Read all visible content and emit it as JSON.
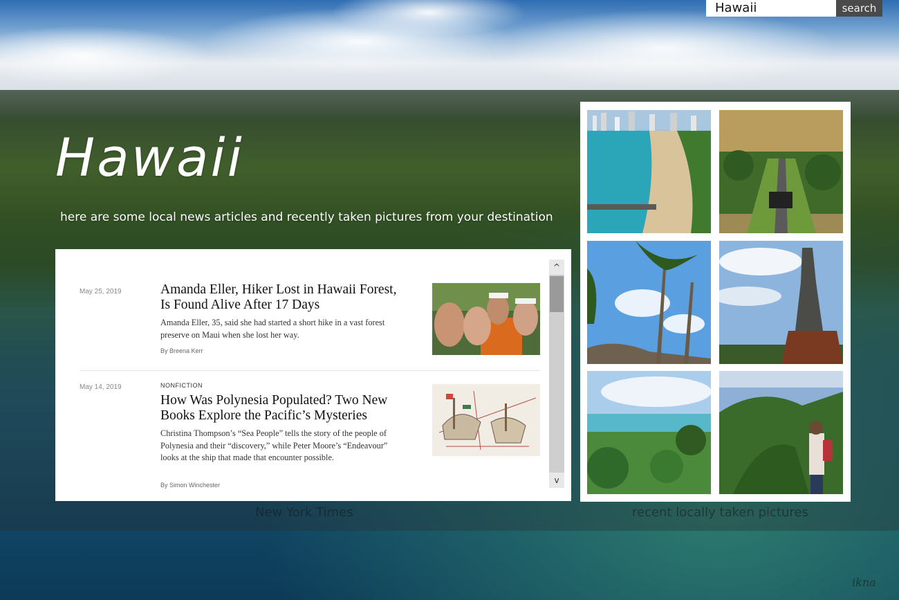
{
  "search": {
    "value": "Hawaii",
    "button_label": "search"
  },
  "hero": {
    "title": "Hawaii",
    "subtitle": "here are some local news articles and recently taken pictures from your destination"
  },
  "news": {
    "articles": [
      {
        "date": "May 25, 2019",
        "kicker": "",
        "title": "Amanda Eller, Hiker Lost in Hawaii Forest, Is Found Alive After 17 Days",
        "summary": "Amanda Eller, 35, said she had started a short hike in a vast forest preserve on Maui when she lost her way.",
        "byline": "By Breena Kerr"
      },
      {
        "date": "May 14, 2019",
        "kicker": "NONFICTION",
        "title": "How Was Polynesia Populated? Two New Books Explore the Pacific’s Mysteries",
        "summary": "Christina Thompson’s “Sea People” tells the story of the people of Polynesia and their “discovery,” while Peter Moore’s “Endeavour” looks at the ship that made that encounter possible.",
        "byline": "By Simon Winchester"
      }
    ],
    "scroll_up": "^",
    "scroll_down": "v"
  },
  "captions": {
    "news": "New York Times",
    "photos": "recent locally taken pictures"
  },
  "signature": "ikna",
  "colors": {
    "search_button_bg": "#4a4a4a",
    "panel_bg": "#ffffff",
    "band_overlay": "rgba(40,45,45,0.35)"
  }
}
